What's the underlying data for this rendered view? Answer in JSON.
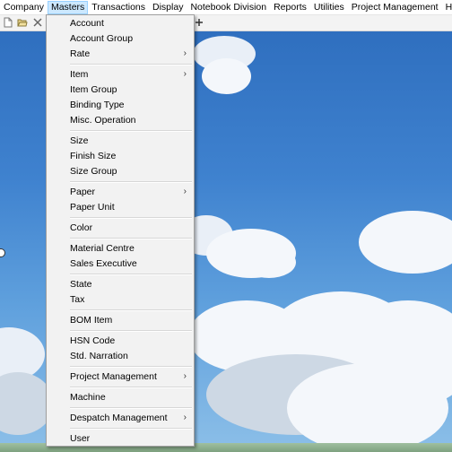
{
  "menubar": {
    "items": [
      {
        "label": "Company"
      },
      {
        "label": "Masters"
      },
      {
        "label": "Transactions"
      },
      {
        "label": "Display"
      },
      {
        "label": "Notebook Division"
      },
      {
        "label": "Reports"
      },
      {
        "label": "Utilities"
      },
      {
        "label": "Project Management"
      },
      {
        "label": "Help"
      }
    ],
    "active_index": 1,
    "active_color": "#cce8ff"
  },
  "toolbar": {
    "icons": [
      "new-document-icon",
      "open-folder-icon",
      "close-icon",
      "add-icon"
    ]
  },
  "masters_menu": {
    "items": [
      {
        "label": "Account",
        "submenu": false
      },
      {
        "label": "Account Group",
        "submenu": false
      },
      {
        "label": "Rate",
        "submenu": true
      },
      {
        "label": "Item",
        "submenu": true
      },
      {
        "label": "Item Group",
        "submenu": false
      },
      {
        "label": "Binding Type",
        "submenu": false
      },
      {
        "label": "Misc. Operation",
        "submenu": false
      },
      {
        "label": "Size",
        "submenu": false
      },
      {
        "label": "Finish Size",
        "submenu": false
      },
      {
        "label": "Size Group",
        "submenu": false
      },
      {
        "label": "Paper",
        "submenu": true
      },
      {
        "label": "Paper Unit",
        "submenu": false
      },
      {
        "label": "Color",
        "submenu": false
      },
      {
        "label": "Material Centre",
        "submenu": false
      },
      {
        "label": "Sales Executive",
        "submenu": false
      },
      {
        "label": "State",
        "submenu": false
      },
      {
        "label": "Tax",
        "submenu": false
      },
      {
        "label": "BOM Item",
        "submenu": false
      },
      {
        "label": "HSN Code",
        "submenu": false
      },
      {
        "label": "Std. Narration",
        "submenu": false
      },
      {
        "label": "Project Management",
        "submenu": true
      },
      {
        "label": "Machine",
        "submenu": false
      },
      {
        "label": "Despatch Management",
        "submenu": true
      },
      {
        "label": "User",
        "submenu": false
      }
    ],
    "submenu_arrow": "›"
  }
}
